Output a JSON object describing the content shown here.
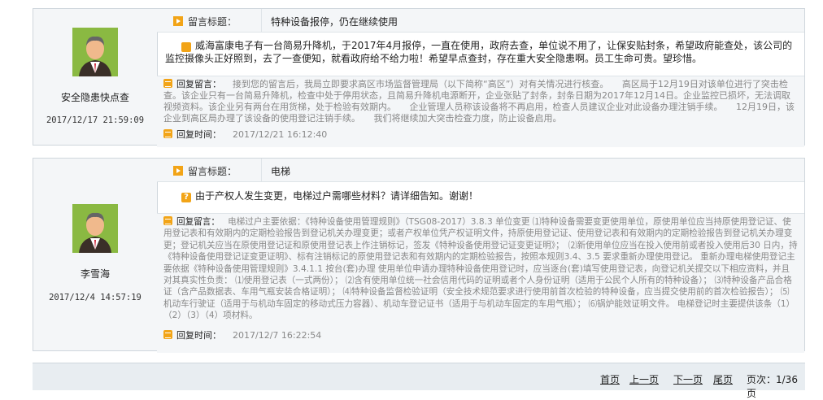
{
  "posts": [
    {
      "user": "安全隐患快点查",
      "date": "2017/12/17 21:59:09",
      "title_label": "留言标题：",
      "title": "特种设备报停，仍在继续使用",
      "question": "威海富康电子有一台简易升降机，于2017年4月报停，一直在使用，政府去查，单位说不用了，让保安贴封条，希望政府能查处，该公司的监控摄像头正好照到，去了一查便知，就看政府给不给力啦！希望早点查封，存在重大安全隐患啊。员工生命可贵。望珍惜。",
      "reply_label": "回复留言：",
      "reply": "接到您的留言后，我局立即要求高区市场监督管理局（以下简称“高区”）对有关情况进行核查。　　高区局于12月19日对该单位进行了突击检查。该企业只有一台简易升降机，检查中处于停用状态，且简易升降机电源断开，企业张贴了封条，封条日期为2017年12月14日。企业监控已损坏，无法调取视频资料。该企业另有两台在用货梯，处于检验有效期内。　　企业管理人员称该设备将不再启用，检查人员建议企业对此设备办理注销手续。　　12月19日，该企业到高区局办理了该设备的使用登记注销手续。　　我们将继续加大突击检查力度，防止设备启用。",
      "time_label": "回复时间：",
      "reply_time": "2017/12/21 16:12:40"
    },
    {
      "user": "李雪海",
      "date": "2017/12/4 14:57:19",
      "title_label": "留言标题：",
      "title": "电梯",
      "question": "由于产权人发生变更，电梯过户需哪些材料？请详细告知。谢谢！",
      "reply_label": "回复留言：",
      "reply": "电梯过户主要依据：《特种设备使用管理规则》（TSG08-2017）3.8.3 单位变更 ⑴特种设备需要变更使用单位，原使用单位应当持原使用登记证、使用登记表和有效期内的定期检验报告到登记机关办理变更；或者产权单位凭产权证明文件，持原使用登记证、使用登记表和有效期内的定期检验报告到登记机关办理变更；登记机关应当在原使用登记证和原使用登记表上作注销标记，签发《特种设备使用登记证变更证明》；　⑵新使用单位应当在投入使用前或者投入使用后30 日内，持《特种设备使用登记证变更证明》、标有注销标记的原使用登记表和有效期内的定期检验报告，按照本规则3.4、3.5 要求重新办理使用登记。 重新办理电梯使用登记主要依据《特种设备使用管理规则》3.4.1.1 按台(套)办理 使用单位申请办理特种设备使用登记时，应当逐台(套)填写使用登记表，向登记机关提交以下相应资料，并且对其真实性负责： ⑴使用登记表（一式两份）； ⑵含有使用单位统一社会信用代码的证明或者个人身份证明（适用于公民个人所有的特种设备）； ⑶特种设备产品合格证（含产品数据表、车用气瓶安装合格证明）； ⑷特种设备监督检验证明（安全技术规范要求进行使用前首次检验的特种设备，应当提交使用前的首次检验报告）； ⑸机动车行驶证（适用于与机动车固定的移动式压力容器）、机动车登记证书（适用于与机动车固定的车用气瓶）； ⑹锅炉能效证明文件。 电梯登记时主要提供该条（1）（2）（3）（4）项材料。",
      "time_label": "回复时间：",
      "reply_time": "2017/12/7 16:22:54"
    }
  ],
  "pager": {
    "first": "首页",
    "prev": "上一页",
    "next": "下一页",
    "last": "尾页",
    "page_info": "页次：1/36页"
  }
}
